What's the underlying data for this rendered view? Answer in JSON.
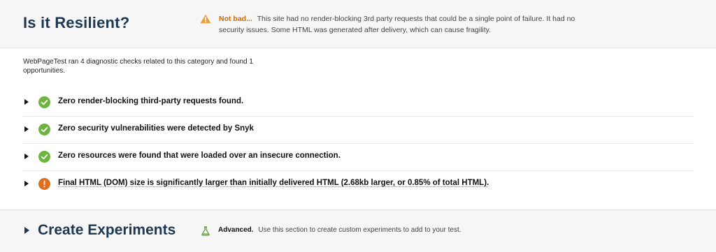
{
  "header": {
    "title": "Is it Resilient?",
    "verdict": "Not bad...",
    "summary": "This site had no render-blocking 3rd party requests that could be a single point of failure. It had no security issues. Some HTML was generated after delivery, which can cause fragility.",
    "verdict_color": "#cc6a00"
  },
  "intro": "WebPageTest ran 4 diagnostic checks related to this category and found 1 opportunities.",
  "checks": [
    {
      "label": "Zero render-blocking third-party requests found.",
      "status": "pass",
      "icon": "check-circle-icon"
    },
    {
      "label": "Zero security vulnerabilities were detected by Snyk",
      "status": "pass",
      "icon": "check-circle-icon"
    },
    {
      "label": "Zero resources were found that were loaded over an insecure connection.",
      "status": "pass",
      "icon": "check-circle-icon"
    },
    {
      "label": "Final HTML (DOM) size is significantly larger than initially delivered HTML (2.68kb larger, or 0.85% of total HTML).",
      "status": "fail",
      "icon": "exclamation-circle-icon"
    }
  ],
  "experiments": {
    "title": "Create Experiments",
    "level": "Advanced.",
    "summary": "Use this section to create custom experiments to add to your test."
  },
  "colors": {
    "pass": "#6cb33f",
    "fail": "#e06e1c",
    "title": "#1e3852"
  }
}
